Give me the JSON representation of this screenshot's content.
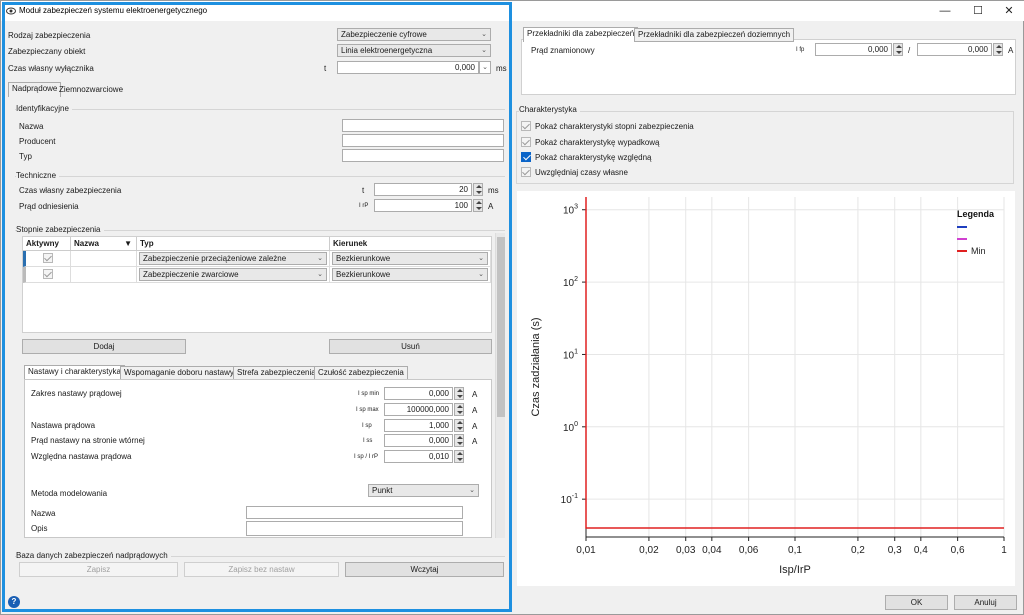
{
  "window": {
    "title": "Moduł zabezpieczeń systemu elektroenergetycznego",
    "minimize": "—",
    "maximize": "☐",
    "close": "✕"
  },
  "top": {
    "rodzaj_label": "Rodzaj zabezpieczenia",
    "rodzaj_value": "Zabezpieczenie cyfrowe",
    "obiekt_label": "Zabezpieczany obiekt",
    "obiekt_value": "Linia elektroenergetyczna",
    "czas_label": "Czas własny wyłącznika",
    "czas_sym": "t",
    "czas_value": "0,000",
    "czas_unit": "ms"
  },
  "main_tabs": [
    "Nadprądowe",
    "Ziemnozwarciowe"
  ],
  "ident": {
    "group": "Identyfikacyjne",
    "nazwa": "Nazwa",
    "producent": "Producent",
    "typ": "Typ"
  },
  "tech": {
    "group": "Techniczne",
    "czas_label": "Czas własny zabezpieczenia",
    "czas_sym": "t",
    "czas_value": "20",
    "czas_unit": "ms",
    "prad_label": "Prąd odniesienia",
    "prad_sym": "I rP",
    "prad_value": "100",
    "prad_unit": "A"
  },
  "stopnie": {
    "group": "Stopnie zabezpieczenia",
    "headers": [
      "Aktywny",
      "Nazwa",
      "Typ",
      "Kierunek"
    ],
    "rows": [
      {
        "typ": "Zabezpieczenie przeciążeniowe zależne",
        "kierunek": "Bezkierunkowe"
      },
      {
        "typ": "Zabezpieczenie zwarciowe",
        "kierunek": "Bezkierunkowe"
      }
    ],
    "add": "Dodaj",
    "remove": "Usuń"
  },
  "sub_tabs": [
    "Nastawy i charakterystyka",
    "Wspomaganie doboru nastawy",
    "Strefa zabezpieczenia",
    "Czułość zabezpieczenia"
  ],
  "nastawy": {
    "zakres_label": "Zakres nastawy prądowej",
    "min_sym": "I sp min",
    "min_value": "0,000",
    "min_unit": "A",
    "max_sym": "I sp max",
    "max_value": "100000,000",
    "max_unit": "A",
    "nast_label": "Nastawa prądowa",
    "nast_sym": "I sp",
    "nast_value": "1,000",
    "nast_unit": "A",
    "wt_label": "Prąd nastawy na stronie wtórnej",
    "wt_sym": "I ss",
    "wt_value": "0,000",
    "wt_unit": "A",
    "wzgl_label": "Względna nastawa prądowa",
    "wzgl_sym": "I sp / I rP",
    "wzgl_value": "0,010",
    "metoda_label": "Metoda modelowania",
    "metoda_value": "Punkt",
    "nazwa_label": "Nazwa",
    "opis_label": "Opis"
  },
  "baza": {
    "group": "Baza danych zabezpieczeń nadprądowych",
    "zapisz": "Zapisz",
    "zapisz_bez": "Zapisz bez nastaw",
    "wczytaj": "Wczytaj"
  },
  "right_tabs": [
    "Przekładniki dla zabezpieczeń",
    "Przekładniki dla zabezpieczeń doziemnych"
  ],
  "przekl": {
    "label": "Prąd znamionowy",
    "sym": "I fp",
    "v1": "0,000",
    "sep": "/",
    "v2": "0,000",
    "unit": "A"
  },
  "charakt": {
    "group": "Charakterystyka",
    "opts": [
      {
        "label": "Pokaż charakterystyki stopni zabezpieczenia",
        "state": "gray"
      },
      {
        "label": "Pokaż charakterystykę wypadkową",
        "state": "gray"
      },
      {
        "label": "Pokaż charakterystykę względną",
        "state": "on"
      },
      {
        "label": "Uwzględniaj czasy własne",
        "state": "gray"
      }
    ]
  },
  "chart_data": {
    "type": "line",
    "xlabel": "Isp/IrP",
    "ylabel": "Czas zadziałania (s)",
    "xscale": "log",
    "yscale": "log",
    "xlim": [
      0.01,
      1
    ],
    "ylim": [
      0.03,
      1500
    ],
    "x_ticks": [
      "0,01",
      "0,02",
      "0,03",
      "0,04",
      "0,06",
      "0,1",
      "0,2",
      "0,3",
      "0,4",
      "0,6",
      "1"
    ],
    "x_tick_values": [
      0.01,
      0.02,
      0.03,
      0.04,
      0.06,
      0.1,
      0.2,
      0.3,
      0.4,
      0.6,
      1
    ],
    "y_ticks": [
      {
        "base": "10",
        "exp": "3",
        "v": 1000
      },
      {
        "base": "10",
        "exp": "2",
        "v": 100
      },
      {
        "base": "10",
        "exp": "1",
        "v": 10
      },
      {
        "base": "10",
        "exp": "0",
        "v": 1
      },
      {
        "base": "10",
        "exp": "-1",
        "v": 0.1
      }
    ],
    "grid": true,
    "legend": {
      "title": "Legenda",
      "position": "top-right",
      "entries": [
        {
          "name": "",
          "color": "#1f3fbf"
        },
        {
          "name": "",
          "color": "#d040d0"
        },
        {
          "name": "Min",
          "color": "#e02020"
        }
      ]
    },
    "series": [
      {
        "name": "Min",
        "color": "#e02020",
        "x": [
          0.01,
          0.01,
          1
        ],
        "y": [
          1500,
          0.04,
          0.04
        ]
      }
    ]
  },
  "footer": {
    "ok": "OK",
    "cancel": "Anuluj",
    "help_icon": "help-icon"
  }
}
